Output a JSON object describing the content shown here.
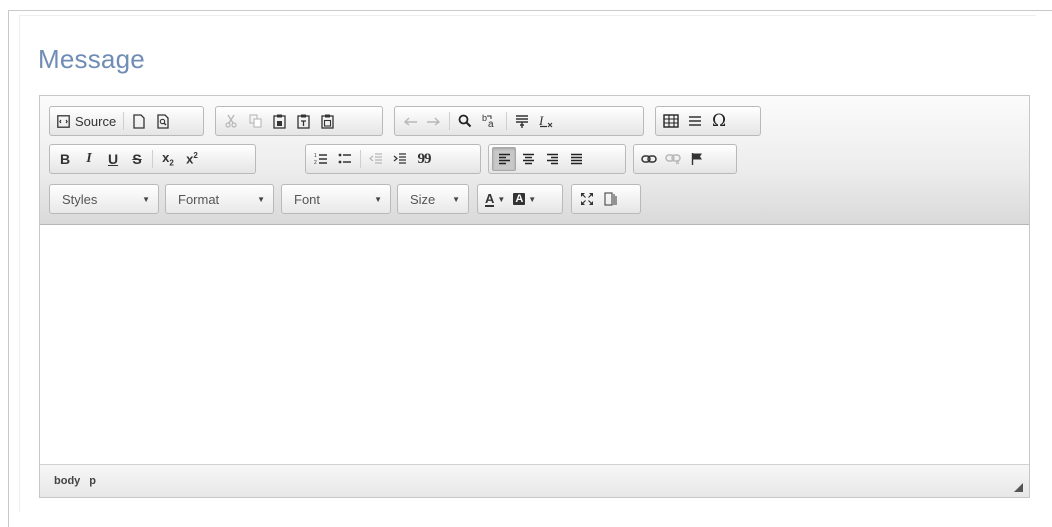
{
  "form": {
    "title": "Message"
  },
  "toolbar": {
    "source_label": "Source",
    "combos": {
      "styles": "Styles",
      "format": "Format",
      "font": "Font",
      "size": "Size"
    },
    "text_color_glyph": "A",
    "bg_color_glyph": "A",
    "bold_glyph": "B",
    "italic_glyph": "I",
    "underline_glyph": "U",
    "strike_glyph": "S",
    "quote_glyph": "99"
  },
  "statusbar": {
    "path": [
      "body",
      "p"
    ]
  },
  "colors": {
    "title": "#6f8db5",
    "active_button": "#c8c8c8"
  },
  "icons": [
    "source-icon",
    "new-page-icon",
    "preview-icon",
    "cut-icon",
    "copy-icon",
    "paste-icon",
    "paste-text-icon",
    "paste-word-icon",
    "undo-icon",
    "redo-icon",
    "find-icon",
    "replace-icon",
    "select-all-icon",
    "remove-format-icon",
    "table-icon",
    "horizontal-rule-icon",
    "special-char-icon",
    "numbered-list-icon",
    "bulleted-list-icon",
    "outdent-icon",
    "indent-icon",
    "blockquote-icon",
    "align-left-icon",
    "align-center-icon",
    "align-right-icon",
    "justify-icon",
    "link-icon",
    "unlink-icon",
    "anchor-icon",
    "maximize-icon",
    "show-blocks-icon"
  ]
}
